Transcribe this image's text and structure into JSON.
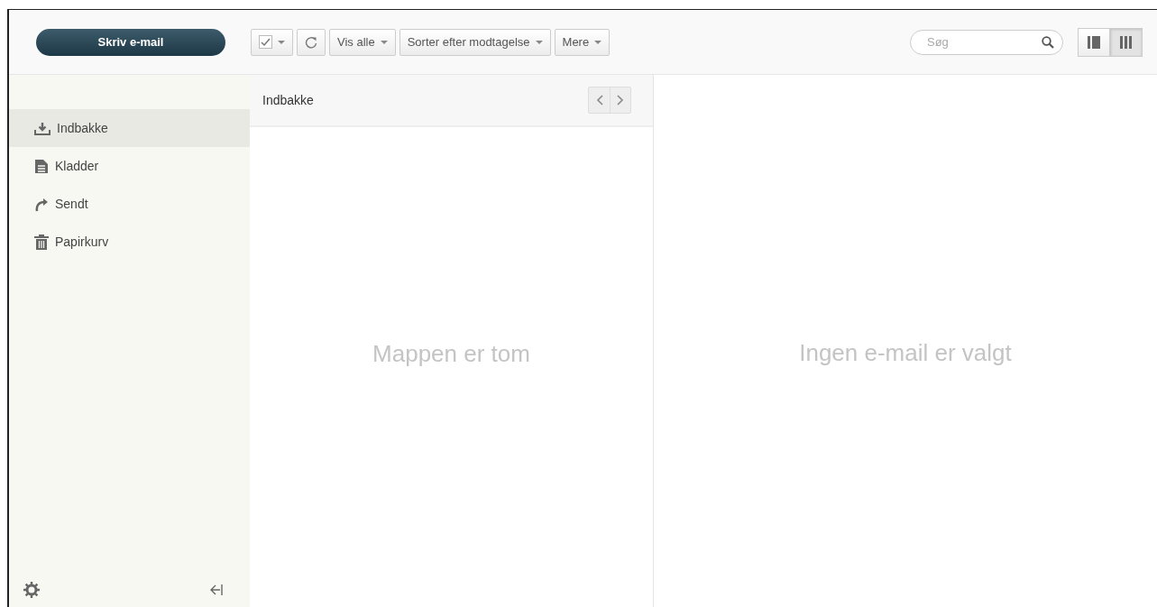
{
  "compose_button": "Skriv e-mail",
  "toolbar": [
    {
      "kind": "checkbox"
    },
    {
      "kind": "refresh"
    },
    {
      "kind": "dropdown",
      "label": "Vis alle"
    },
    {
      "kind": "dropdown",
      "label": "Sorter efter modtagelse"
    },
    {
      "kind": "dropdown",
      "label": "Mere"
    }
  ],
  "search": {
    "placeholder": "Søg"
  },
  "view_buttons": [
    {
      "kind": "two-pane",
      "selected": false
    },
    {
      "kind": "three-pane",
      "selected": true
    }
  ],
  "folders": [
    {
      "label": "Indbakke",
      "kind": "inbox",
      "selected": true
    },
    {
      "label": "Kladder",
      "kind": "drafts",
      "selected": false
    },
    {
      "label": "Sendt",
      "kind": "sent",
      "selected": false
    },
    {
      "label": "Papirkurv",
      "kind": "trash",
      "selected": false
    }
  ],
  "message_list": {
    "title": "Indbakke",
    "empty_text": "Mappen er tom"
  },
  "reading_pane": {
    "empty_text": "Ingen e-mail er valgt"
  }
}
